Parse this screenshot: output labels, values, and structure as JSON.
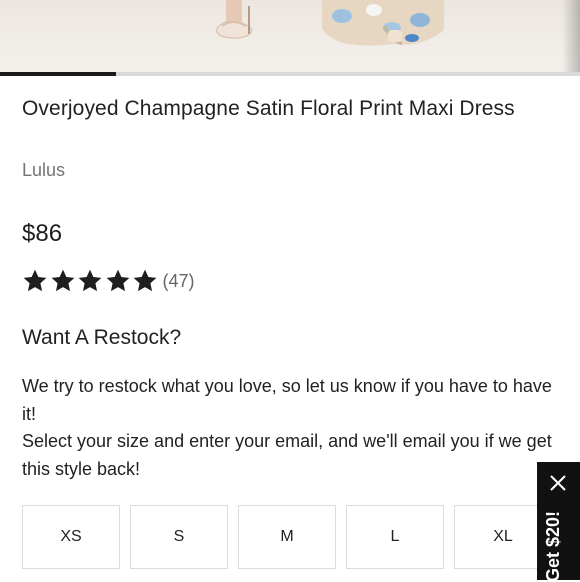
{
  "product": {
    "title": "Overjoyed Champagne Satin Floral Print Maxi Dress",
    "brand": "Lulus",
    "price": "$86",
    "rating": {
      "stars": 5,
      "count_label": "(47)"
    }
  },
  "gallery": {
    "progress_fraction": 0.2
  },
  "restock": {
    "heading": "Want A Restock?",
    "line1": "We try to restock what you love, so let us know if you have to have it!",
    "line2": "Select your size and enter your email, and we'll email you if we get this style back!"
  },
  "sizes": [
    "XS",
    "S",
    "M",
    "L",
    "XL"
  ],
  "promo": {
    "label": "Get $20!",
    "close_icon": "close-icon"
  },
  "colors": {
    "text": "#222222",
    "muted": "#757575",
    "promo_bg": "#111111"
  }
}
